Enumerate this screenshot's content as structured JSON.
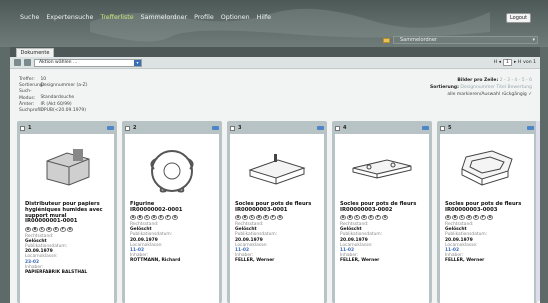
{
  "menu": [
    "Suche",
    "Expertensuche",
    "Trefferliste",
    "Sammelordner",
    "Profile",
    "Optionen",
    "Hilfe"
  ],
  "logout": "Logout",
  "folder_select": "Sammelordner",
  "tab": "Dokumente",
  "action_select": "Aktion wählen ...",
  "pager": {
    "prev": "H ◂",
    "page": "1",
    "next": "▸ H",
    "total": "von 1"
  },
  "info": {
    "rows": [
      {
        "k": "Treffer:",
        "v": "10"
      },
      {
        "k": "Sortierung:",
        "v": "Designnummer (a-Z)"
      },
      {
        "k": "Such-Modus:",
        "v": "Standardsuche"
      },
      {
        "k": "Ämter:",
        "v": "IR (Akt 60/99)"
      },
      {
        "k": "Suchprofil:",
        "v": "DPUB(<20.09.1979)"
      }
    ]
  },
  "right_info": {
    "per_row_label": "Bilder pro Zeile:",
    "per_row_values": "2 - 3 - 4 - 5 - 6",
    "sort_label": "Sortierung:",
    "sort_values": "Designnummer  Titel  Bewertung",
    "mark_all": "alle markieren/Auswahl rückgängig"
  },
  "cards": [
    {
      "n": "1",
      "title": "Distributeur pour papiers hygiéniques humides avec support mural",
      "num": "IR00000001-0001",
      "status_label": "Rechtsstand:",
      "status": "Gelöscht",
      "pub_label": "Publikationsdatum:",
      "pub": "20.09.1979",
      "loc_label": "Locarnoklasse:",
      "loc": "23-02",
      "owner_label": "Inhaber:",
      "owner": "PAPIERFABRIK BALSTHAL"
    },
    {
      "n": "2",
      "title": "Figurine",
      "num": "IR00000002-0001",
      "status_label": "Rechtsstand:",
      "status": "Gelöscht",
      "pub_label": "Publikationsdatum:",
      "pub": "20.09.1979",
      "loc_label": "Locarnoklasse:",
      "loc": "11-02",
      "owner_label": "Inhaber:",
      "owner": "ROTTMANN, Richard"
    },
    {
      "n": "3",
      "title": "Socles pour pots de fleurs",
      "num": "IR00000003-0001",
      "status_label": "Rechtsstand:",
      "status": "Gelöscht",
      "pub_label": "Publikationsdatum:",
      "pub": "20.09.1979",
      "loc_label": "Locarnoklasse:",
      "loc": "11-02",
      "owner_label": "Inhaber:",
      "owner": "FELLER, Werner"
    },
    {
      "n": "4",
      "title": "Socles pour pots de fleurs",
      "num": "IR00000003-0002",
      "status_label": "Rechtsstand:",
      "status": "Gelöscht",
      "pub_label": "Publikationsdatum:",
      "pub": "20.09.1979",
      "loc_label": "Locarnoklasse:",
      "loc": "11-02",
      "owner_label": "Inhaber:",
      "owner": "FELLER, Werner"
    },
    {
      "n": "5",
      "title": "Socles pour pots de fleurs",
      "num": "IR00000003-0003",
      "status_label": "Rechtsstand:",
      "status": "Gelöscht",
      "pub_label": "Publikationsdatum:",
      "pub": "20.09.1979",
      "loc_label": "Locarnoklasse:",
      "loc": "11-02",
      "owner_label": "Inhaber:",
      "owner": "FELLER, Werner"
    }
  ],
  "chips": [
    "A",
    "B",
    "C",
    "D",
    "E",
    "F",
    "G"
  ],
  "colors": {
    "active_menu": "#c7e27a",
    "accent": "#3869b8"
  }
}
